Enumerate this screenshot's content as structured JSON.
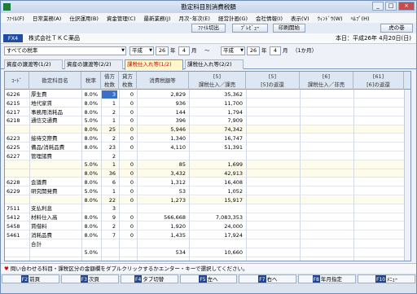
{
  "window": {
    "title": "勘定科目別消費税額",
    "minimize": "_",
    "maximize": "□",
    "close": "×"
  },
  "menu": [
    "ﾌｧｲﾙ(F)",
    "日常業務(A)",
    "仕訳運用(B)",
    "資金管理(C)",
    "最新業務(J)",
    "月次･年次(E)",
    "経営計画(G)",
    "会社情報(I)",
    "表示(V)",
    "ｳｨﾝﾄﾞｳ(W)",
    "ﾍﾙﾌﾟ(H)"
  ],
  "toolbar": {
    "file_output": "ﾌｧｲﾙ切出",
    "preview": "ﾌﾟﾚﾋﾞｭｰ",
    "print": "印刷開始",
    "manual": "虎の巻"
  },
  "company": {
    "badge": "FX4",
    "name": "株式会社ＴＫＣ薬品",
    "today": "本日：平成26年 4月20日(日)"
  },
  "filter": {
    "tax_rate": "すべての税率",
    "era_from": "平成",
    "year_from": "26",
    "label_year_from": "年",
    "month_from": "4",
    "label_month_from": "月",
    "separator": "～",
    "era_to": "平成",
    "year_to": "26",
    "label_year_to": "年",
    "month_to": "4",
    "label_month_to": "月",
    "months": "（1か月）"
  },
  "tabs": [
    "資産の譲渡等(1/2)",
    "資産の譲渡等(2/2)",
    "課税仕入れ等(1/2)",
    "課税仕入れ等(2/2)"
  ],
  "active_tab": 2,
  "columns": {
    "code": "ｺｰﾄﾞ",
    "name": "勘定科目名",
    "rate": "税率",
    "debit": "借方\n枚数",
    "credit": "貸方\n枚数",
    "tax": "消費税額等",
    "c5": "[5]\n課税仕入／課売",
    "c5b": "[5]\n[5]の返還",
    "c6": "[6]\n課税仕入／非売",
    "c61": "[61]\n[6]の返還"
  },
  "rows": [
    {
      "code": "6226",
      "name": "厚生費",
      "rate": "8.0%",
      "debit": "3",
      "credit": "0",
      "tax": "2,829",
      "amount": "35,362",
      "alt": false
    },
    {
      "code": "6215",
      "name": "地代家賃",
      "rate": "8.0%",
      "debit": "1",
      "credit": "0",
      "tax": "936",
      "amount": "11,700",
      "alt": false
    },
    {
      "code": "6217",
      "name": "事務用消耗品",
      "rate": "8.0%",
      "debit": "2",
      "credit": "0",
      "tax": "144",
      "amount": "1,794",
      "alt": false
    },
    {
      "code": "6218",
      "name": "通信交通費",
      "rate": "5.0%",
      "debit": "1",
      "credit": "0",
      "tax": "396",
      "amount": "7,909",
      "alt": false
    },
    {
      "code": "",
      "name": "",
      "rate": "8.0%",
      "debit": "25",
      "credit": "0",
      "tax": "5,946",
      "amount": "74,342",
      "alt": true
    },
    {
      "code": "6223",
      "name": "接待交際費",
      "rate": "8.0%",
      "debit": "2",
      "credit": "0",
      "tax": "1,340",
      "amount": "16,747",
      "alt": false
    },
    {
      "code": "6225",
      "name": "備品/消耗品費",
      "rate": "8.0%",
      "debit": "23",
      "credit": "0",
      "tax": "4,110",
      "amount": "51,391",
      "alt": false
    },
    {
      "code": "6227",
      "name": "管理諸費",
      "rate": "",
      "debit": "2",
      "credit": "",
      "tax": "",
      "amount": "",
      "alt": false
    },
    {
      "code": "",
      "name": "",
      "rate": "5.0%",
      "debit": "1",
      "credit": "0",
      "tax": "85",
      "amount": "1,699",
      "alt": true
    },
    {
      "code": "",
      "name": "",
      "rate": "8.0%",
      "debit": "36",
      "credit": "0",
      "tax": "3,432",
      "amount": "42,913",
      "alt": true
    },
    {
      "code": "6228",
      "name": "会議費",
      "rate": "8.0%",
      "debit": "6",
      "credit": "0",
      "tax": "1,312",
      "amount": "16,408",
      "alt": false
    },
    {
      "code": "6229",
      "name": "研究開発費",
      "rate": "5.0%",
      "debit": "1",
      "credit": "0",
      "tax": "53",
      "amount": "1,052",
      "alt": false
    },
    {
      "code": "",
      "name": "",
      "rate": "8.0%",
      "debit": "22",
      "credit": "0",
      "tax": "1,273",
      "amount": "15,917",
      "alt": true
    },
    {
      "code": "7511",
      "name": "支払利息",
      "rate": "",
      "debit": "3",
      "credit": "",
      "tax": "",
      "amount": "",
      "alt": false
    },
    {
      "code": "5412",
      "name": "材料仕入高",
      "rate": "8.0%",
      "debit": "9",
      "credit": "0",
      "tax": "566,668",
      "amount": "7,083,353",
      "alt": false
    },
    {
      "code": "5458",
      "name": "賃借料",
      "rate": "8.0%",
      "debit": "2",
      "credit": "0",
      "tax": "1,920",
      "amount": "24,000",
      "alt": false
    },
    {
      "code": "5461",
      "name": "消耗品費",
      "rate": "8.0%",
      "debit": "7",
      "credit": "0",
      "tax": "1,435",
      "amount": "17,924",
      "alt": false
    },
    {
      "code": "",
      "name": "合計",
      "rate": "",
      "debit": "",
      "credit": "",
      "tax": "",
      "amount": "",
      "alt": false
    },
    {
      "code": "",
      "name": "",
      "rate": "5.0%",
      "debit": "",
      "credit": "",
      "tax": "534",
      "amount": "10,660",
      "alt": false
    }
  ],
  "status": "問い合わせる科目・課税区分の金額欄をダブルクリックするかエンター・キーで選択してください。",
  "fkeys": [
    {
      "key": "F2",
      "label": "前頁"
    },
    {
      "key": "F3",
      "label": "次頁"
    },
    {
      "key": "F4",
      "label": "タブ切替"
    },
    {
      "key": "F5",
      "label": "左へ"
    },
    {
      "key": "F7",
      "label": "右へ"
    },
    {
      "key": "F8",
      "label": "年月指定"
    },
    {
      "key": "F10",
      "label": "ﾒﾆｭｰ"
    }
  ]
}
